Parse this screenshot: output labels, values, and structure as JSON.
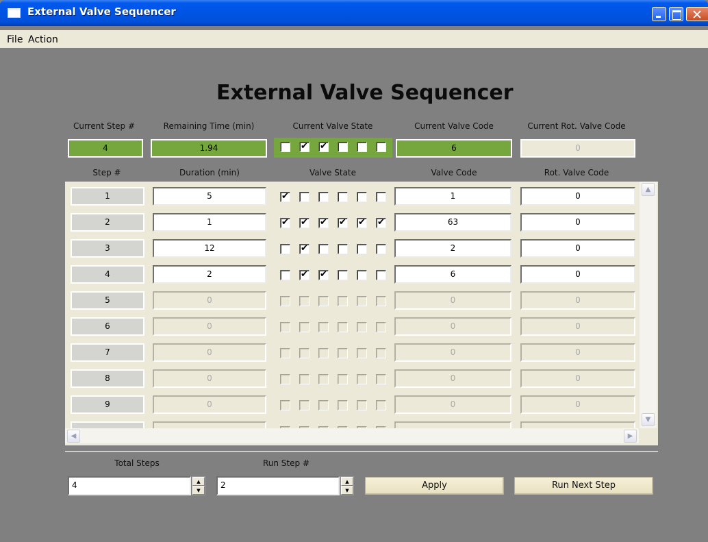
{
  "window": {
    "title": "External Valve Sequencer"
  },
  "menu": {
    "file": "File",
    "action": "Action"
  },
  "main_title": "External Valve Sequencer",
  "status": {
    "labels": {
      "step": "Current Step #",
      "remaining": "Remaining Time (min)",
      "valve_state": "Current Valve State",
      "valve_code": "Current Valve Code",
      "rot_code": "Current Rot. Valve Code"
    },
    "current_step": "4",
    "remaining_time": "1.94",
    "valve_state": [
      false,
      true,
      true,
      false,
      false,
      false
    ],
    "valve_code": "6",
    "rot_valve_code": "0"
  },
  "table": {
    "headers": {
      "step": "Step #",
      "duration": "Duration (min)",
      "valve_state": "Valve State",
      "valve_code": "Valve Code",
      "rot_code": "Rot. Valve Code"
    },
    "rows": [
      {
        "step": "1",
        "duration": "5",
        "valves": [
          true,
          false,
          false,
          false,
          false,
          false
        ],
        "valve_code": "1",
        "rot_code": "0",
        "enabled": true
      },
      {
        "step": "2",
        "duration": "1",
        "valves": [
          true,
          true,
          true,
          true,
          true,
          true
        ],
        "valve_code": "63",
        "rot_code": "0",
        "enabled": true
      },
      {
        "step": "3",
        "duration": "12",
        "valves": [
          false,
          true,
          false,
          false,
          false,
          false
        ],
        "valve_code": "2",
        "rot_code": "0",
        "enabled": true
      },
      {
        "step": "4",
        "duration": "2",
        "valves": [
          false,
          true,
          true,
          false,
          false,
          false
        ],
        "valve_code": "6",
        "rot_code": "0",
        "enabled": true
      },
      {
        "step": "5",
        "duration": "0",
        "valves": [
          false,
          false,
          false,
          false,
          false,
          false
        ],
        "valve_code": "0",
        "rot_code": "0",
        "enabled": false
      },
      {
        "step": "6",
        "duration": "0",
        "valves": [
          false,
          false,
          false,
          false,
          false,
          false
        ],
        "valve_code": "0",
        "rot_code": "0",
        "enabled": false
      },
      {
        "step": "7",
        "duration": "0",
        "valves": [
          false,
          false,
          false,
          false,
          false,
          false
        ],
        "valve_code": "0",
        "rot_code": "0",
        "enabled": false
      },
      {
        "step": "8",
        "duration": "0",
        "valves": [
          false,
          false,
          false,
          false,
          false,
          false
        ],
        "valve_code": "0",
        "rot_code": "0",
        "enabled": false
      },
      {
        "step": "9",
        "duration": "0",
        "valves": [
          false,
          false,
          false,
          false,
          false,
          false
        ],
        "valve_code": "0",
        "rot_code": "0",
        "enabled": false
      }
    ]
  },
  "controls": {
    "total_steps_label": "Total Steps",
    "total_steps": "4",
    "run_step_label": "Run Step #",
    "run_step": "2",
    "apply_label": "Apply",
    "run_next_label": "Run Next Step"
  },
  "colors": {
    "accent_green": "#76a73e",
    "background": "#808080",
    "panel": "#ece9d8",
    "titlebar": "#0054e3"
  },
  "icons": {
    "window": "app-window-icon",
    "minimize": "minimize-icon",
    "maximize": "maximize-icon",
    "close": "close-icon",
    "check": "checkmark-icon",
    "scroll_up": "arrow-up-icon",
    "scroll_down": "arrow-down-icon",
    "scroll_left": "arrow-left-icon",
    "scroll_right": "arrow-right-icon",
    "spin_up": "spin-up-icon",
    "spin_down": "spin-down-icon"
  }
}
